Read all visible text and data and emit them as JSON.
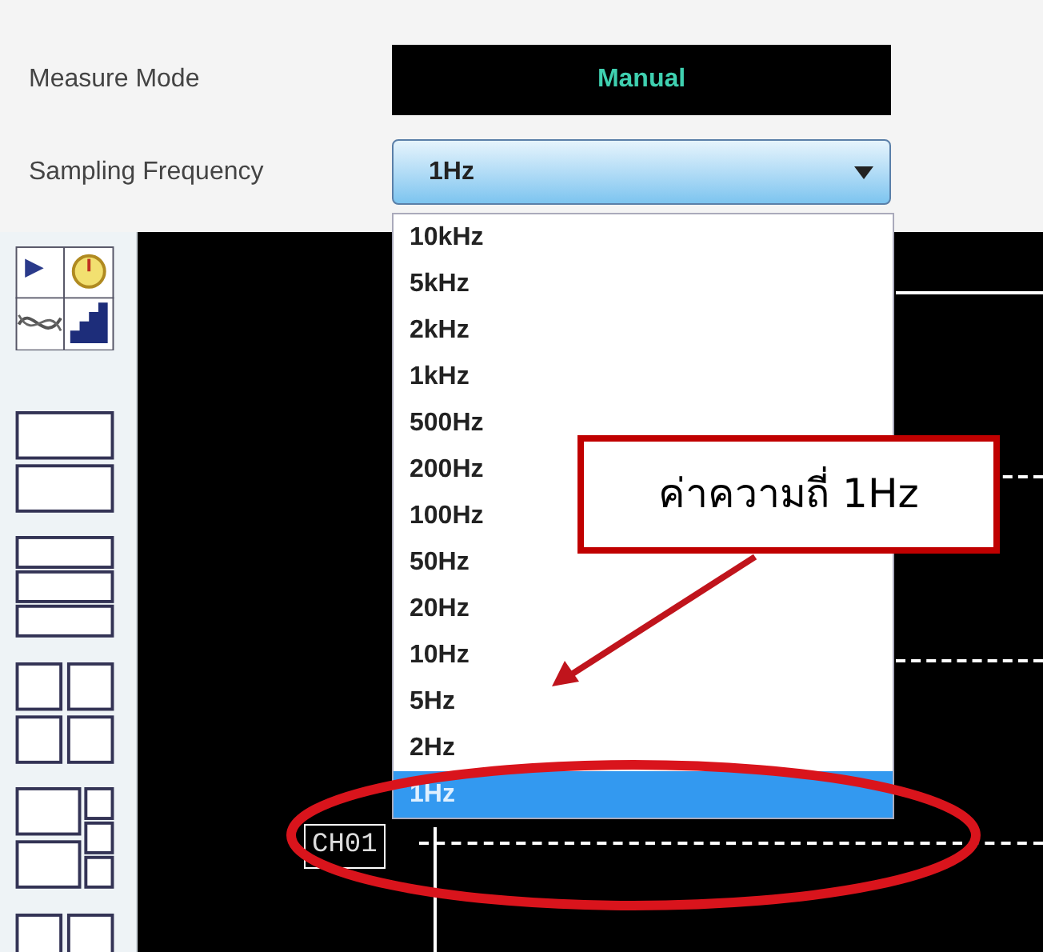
{
  "measure_mode": {
    "label": "Measure Mode",
    "value": "Manual"
  },
  "sampling_frequency": {
    "label": "Sampling Frequency",
    "value": "1Hz",
    "expanded": true,
    "options": [
      {
        "label": "10kHz",
        "selected": false
      },
      {
        "label": "5kHz",
        "selected": false
      },
      {
        "label": "2kHz",
        "selected": false
      },
      {
        "label": "1kHz",
        "selected": false
      },
      {
        "label": "500Hz",
        "selected": false
      },
      {
        "label": "200Hz",
        "selected": false
      },
      {
        "label": "100Hz",
        "selected": false
      },
      {
        "label": "50Hz",
        "selected": false
      },
      {
        "label": "20Hz",
        "selected": false
      },
      {
        "label": "10Hz",
        "selected": false
      },
      {
        "label": "5Hz",
        "selected": false
      },
      {
        "label": "2Hz",
        "selected": false
      },
      {
        "label": "1Hz",
        "selected": true
      }
    ]
  },
  "scope": {
    "channel_label": "CH01"
  },
  "annotation": {
    "text": "ค่าความถี่ 1Hz"
  }
}
